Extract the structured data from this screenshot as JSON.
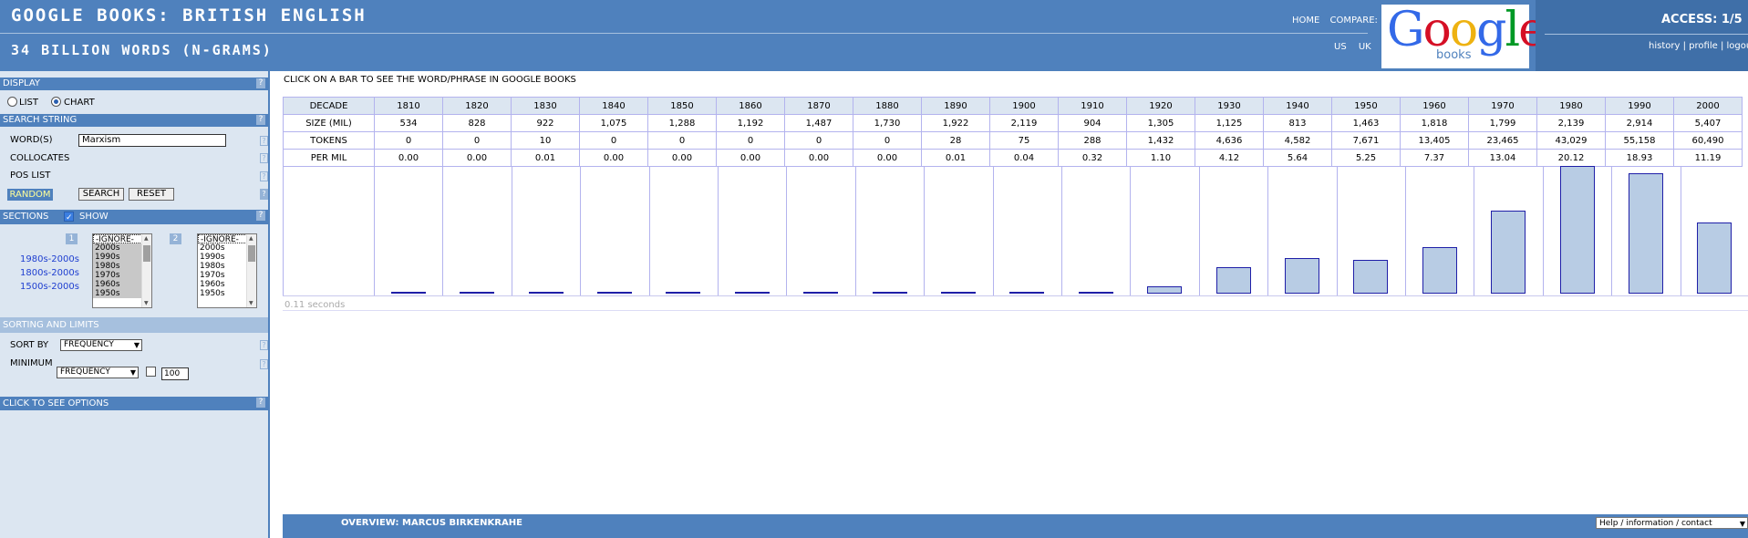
{
  "header": {
    "title": "GOOGLE BOOKS: BRITISH ENGLISH",
    "subtitle": "34 BILLION WORDS  (N-GRAMS)",
    "nav_home": "HOME",
    "nav_compare": "COMPARE:",
    "country_us": "US",
    "country_uk": "UK",
    "logo_text": "Google",
    "logo_sub": "books",
    "access": "ACCESS:  1/5",
    "link_history": "history",
    "link_profile": "profile",
    "link_logout": "logout",
    "sep": "|"
  },
  "sidebar": {
    "display_title": "DISPLAY",
    "help_glyph": "?",
    "list_label": "LIST",
    "chart_label": "CHART",
    "display_mode": "chart",
    "search_title": "SEARCH STRING",
    "words_label": "WORD(S)",
    "words_value": "Marxism",
    "collocates_label": "COLLOCATES",
    "pos_label": "POS LIST",
    "random_label": "RANDOM",
    "search_button": "SEARCH",
    "reset_button": "RESET",
    "sections_title": "SECTIONS",
    "show_label": "SHOW",
    "section1_num": "1",
    "section2_num": "2",
    "section_options": [
      "-IGNORE-",
      "2000s",
      "1990s",
      "1980s",
      "1970s",
      "1960s",
      "1950s"
    ],
    "presets": [
      "1980s-2000s",
      "1800s-2000s",
      "1500s-2000s"
    ],
    "sorting_title": "SORTING AND LIMITS",
    "sort_by_label": "SORT BY",
    "sort_by_value": "FREQUENCY",
    "minimum_label": "MINIMUM",
    "minimum_value": "FREQUENCY",
    "minimum_number": "100",
    "options_title": "CLICK TO SEE OPTIONS"
  },
  "main": {
    "instruction": "CLICK ON A BAR TO SEE THE WORD/PHRASE IN GOOGLE BOOKS",
    "row_labels": {
      "decade": "DECADE",
      "size": "SIZE (MIL)",
      "tokens": "TOKENS",
      "per_mil": "PER MIL"
    },
    "timing": "0.11 seconds"
  },
  "chart_data": {
    "type": "bar",
    "categories": [
      "1810",
      "1820",
      "1830",
      "1840",
      "1850",
      "1860",
      "1870",
      "1880",
      "1890",
      "1900",
      "1910",
      "1920",
      "1930",
      "1940",
      "1950",
      "1960",
      "1970",
      "1980",
      "1990",
      "2000"
    ],
    "size_mil": [
      "534",
      "828",
      "922",
      "1,075",
      "1,288",
      "1,192",
      "1,487",
      "1,730",
      "1,922",
      "2,119",
      "904",
      "1,305",
      "1,125",
      "813",
      "1,463",
      "1,818",
      "1,799",
      "2,139",
      "2,914",
      "5,407"
    ],
    "tokens": [
      "0",
      "0",
      "10",
      "0",
      "0",
      "0",
      "0",
      "0",
      "28",
      "75",
      "288",
      "1,432",
      "4,636",
      "4,582",
      "7,671",
      "13,405",
      "23,465",
      "43,029",
      "55,158",
      "60,490"
    ],
    "per_mil": [
      "0.00",
      "0.00",
      "0.01",
      "0.00",
      "0.00",
      "0.00",
      "0.00",
      "0.00",
      "0.01",
      "0.04",
      "0.32",
      "1.10",
      "4.12",
      "5.64",
      "5.25",
      "7.37",
      "13.04",
      "20.12",
      "18.93",
      "11.19"
    ],
    "values": [
      0.0,
      0.0,
      0.01,
      0.0,
      0.0,
      0.0,
      0.0,
      0.0,
      0.01,
      0.04,
      0.32,
      1.1,
      4.12,
      5.64,
      5.25,
      7.37,
      13.04,
      20.12,
      18.93,
      11.19
    ],
    "bar_fill": "#b8cce4",
    "bar_stroke": "#1f1fa8"
  },
  "footer": {
    "overview": "OVERVIEW: MARCUS BIRKENKRAHE",
    "help_select": "Help / information / contact"
  }
}
